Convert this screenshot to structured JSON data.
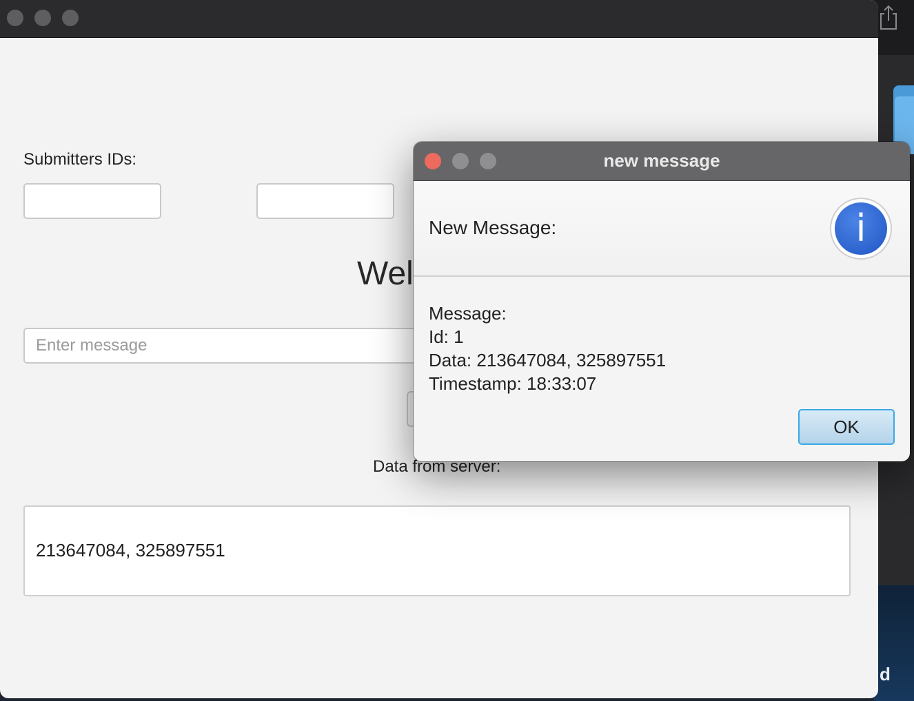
{
  "desktop": {
    "partial_label": "d"
  },
  "main_window": {
    "submitters_label": "Submitters IDs:",
    "id_field_1_value": "",
    "id_field_2_value": "",
    "welcome_partial": "Wel",
    "message_input_placeholder": "Enter message",
    "data_from_server_label": "Data from server:",
    "data_box_text": "213647084, 325897551"
  },
  "dialog": {
    "title": "new message",
    "header": "New Message:",
    "info_glyph": "i",
    "content": {
      "message_label": "Message:",
      "id_line": "Id: 1",
      "data_line": "Data: 213647084, 325897551",
      "timestamp_line": "Timestamp: 18:33:07"
    },
    "ok_label": "OK"
  },
  "colors": {
    "close_red": "#ed6a5e",
    "traffic_grey": "#8f8f92",
    "ok_border": "#3aa8e6",
    "info_blue": "#2b64d4"
  }
}
